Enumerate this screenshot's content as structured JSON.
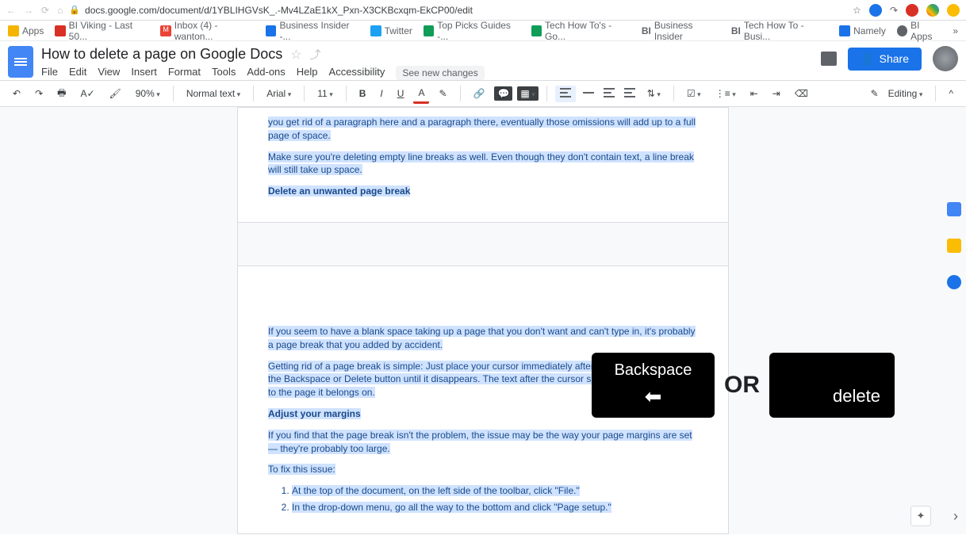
{
  "browser": {
    "url": "docs.google.com/document/d/1YBLIHGVsK_.-Mv4LZaE1kX_Pxn-X3CKBcxqm-EkCP00/edit"
  },
  "bookmarks": [
    {
      "label": "Apps",
      "color": "#f4b400"
    },
    {
      "label": "BI Viking - Last 50...",
      "color": "#d93025"
    },
    {
      "label": "Inbox (4) - wanton...",
      "color": "#ea4335"
    },
    {
      "label": "Business Insider -...",
      "color": "#1a73e8"
    },
    {
      "label": "Twitter",
      "color": "#1da1f2"
    },
    {
      "label": "Top Picks Guides -...",
      "color": "#0f9d58"
    },
    {
      "label": "Tech How To's - Go...",
      "color": "#0f9d58"
    },
    {
      "label": "Business Insider",
      "color": "#202124"
    },
    {
      "label": "Tech How To - Busi...",
      "color": "#202124"
    },
    {
      "label": "Namely",
      "color": "#1a73e8"
    },
    {
      "label": "BI Apps",
      "color": "#5f6368"
    }
  ],
  "doc": {
    "title": "How to delete a page on Google Docs",
    "share": "Share",
    "see_changes": "See new changes",
    "menus": [
      "File",
      "Edit",
      "View",
      "Insert",
      "Format",
      "Tools",
      "Add-ons",
      "Help",
      "Accessibility"
    ]
  },
  "toolbar": {
    "zoom": "90%",
    "style": "Normal text",
    "font": "Arial",
    "size": "11",
    "editing": "Editing"
  },
  "content": {
    "p1": "you get rid of a paragraph here and a paragraph there, eventually those omissions will add up to a full page of space.",
    "p2": "Make sure you're deleting empty line breaks as well. Even though they don't contain text, a line break will still take up space.",
    "h1": "Delete an unwanted page break",
    "p3": "If you seem to have a blank space taking up a page that you don't want and can't type in, it's probably a page break that you added by accident.",
    "p4": "Getting rid of a page break is simple: Just place your cursor immediately after the blank space, and hit the Backspace or Delete button until it disappears. The text after the cursor should then jump back up to the page it belongs on.",
    "h2": "Adjust your margins",
    "p5": "If you find that the page break isn't the problem, the issue may be the way your page margins are set — they're probably too large.",
    "p6": "To fix this issue:",
    "li1": "At the top of the document, on the left side of the toolbar, click \"File.\"",
    "li2": "In the drop-down menu, go all the way to the bottom and click \"Page setup.\""
  },
  "overlay": {
    "backspace": "Backspace",
    "arrow": "⬅",
    "or": "OR",
    "delete": "delete"
  }
}
